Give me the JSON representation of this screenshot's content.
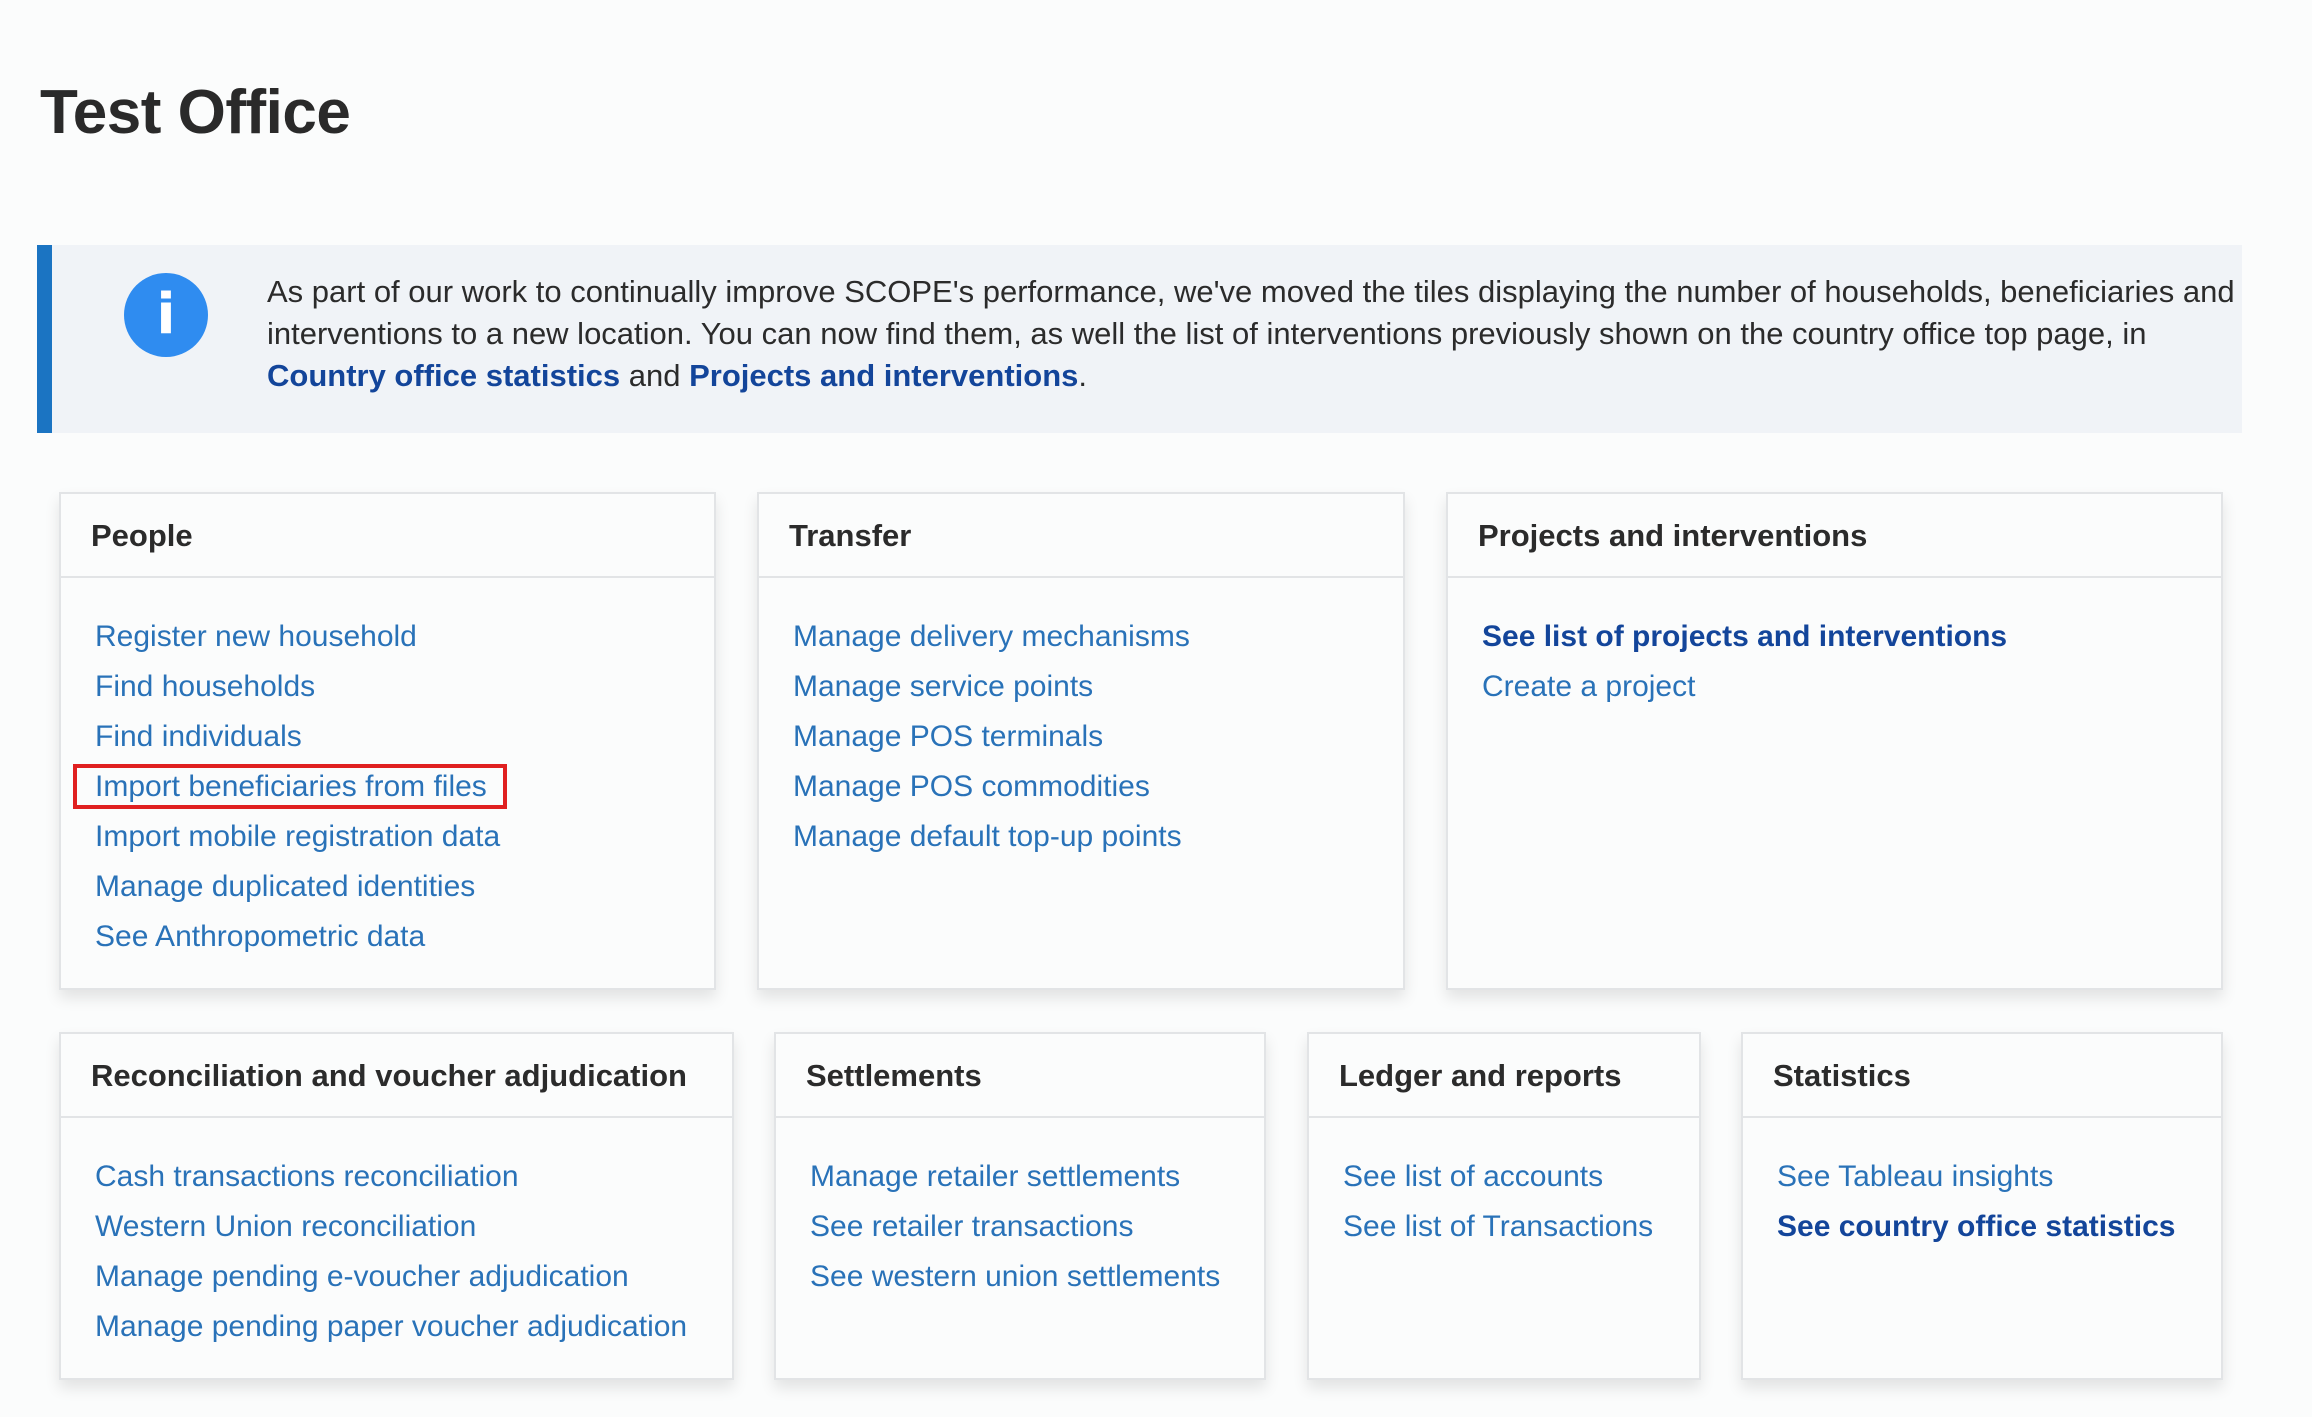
{
  "page": {
    "title": "Test Office"
  },
  "notice": {
    "icon": "info-icon",
    "text_before": "As part of our work to continually improve SCOPE's performance, we've moved the tiles displaying the number of households, beneficiaries and interventions to a new location. You can now find them, as well the list of interventions previously shown on the country office top page, in ",
    "link1": "Country office statistics",
    "text_middle": " and ",
    "link2": "Projects and interventions",
    "text_after": "."
  },
  "cards": {
    "people": {
      "title": "People",
      "links": [
        "Register new household",
        "Find households",
        "Find individuals",
        "Import beneficiaries from files",
        "Import mobile registration data",
        "Manage duplicated identities",
        "See Anthropometric data"
      ]
    },
    "transfer": {
      "title": "Transfer",
      "links": [
        "Manage delivery mechanisms",
        "Manage service points",
        "Manage POS terminals",
        "Manage POS commodities",
        "Manage default top-up points"
      ]
    },
    "projects": {
      "title": "Projects and interventions",
      "links": [
        "See list of projects and interventions",
        "Create a project"
      ]
    },
    "reconciliation": {
      "title": "Reconciliation and voucher adjudication",
      "links": [
        "Cash transactions reconciliation",
        "Western Union reconciliation",
        "Manage pending e-voucher adjudication",
        "Manage pending paper voucher adjudication"
      ]
    },
    "settlements": {
      "title": "Settlements",
      "links": [
        "Manage retailer settlements",
        "See retailer transactions",
        "See western union settlements"
      ]
    },
    "ledger": {
      "title": "Ledger and reports",
      "links": [
        "See list of accounts",
        "See list of Transactions"
      ]
    },
    "statistics": {
      "title": "Statistics",
      "links": [
        "See Tableau insights",
        "See country office statistics"
      ]
    }
  },
  "colors": {
    "accent_bar": "#1b74c2",
    "link": "#2972b8",
    "link_bold": "#13459a",
    "highlight": "#e02020",
    "info_icon": "#2f8cf0"
  }
}
